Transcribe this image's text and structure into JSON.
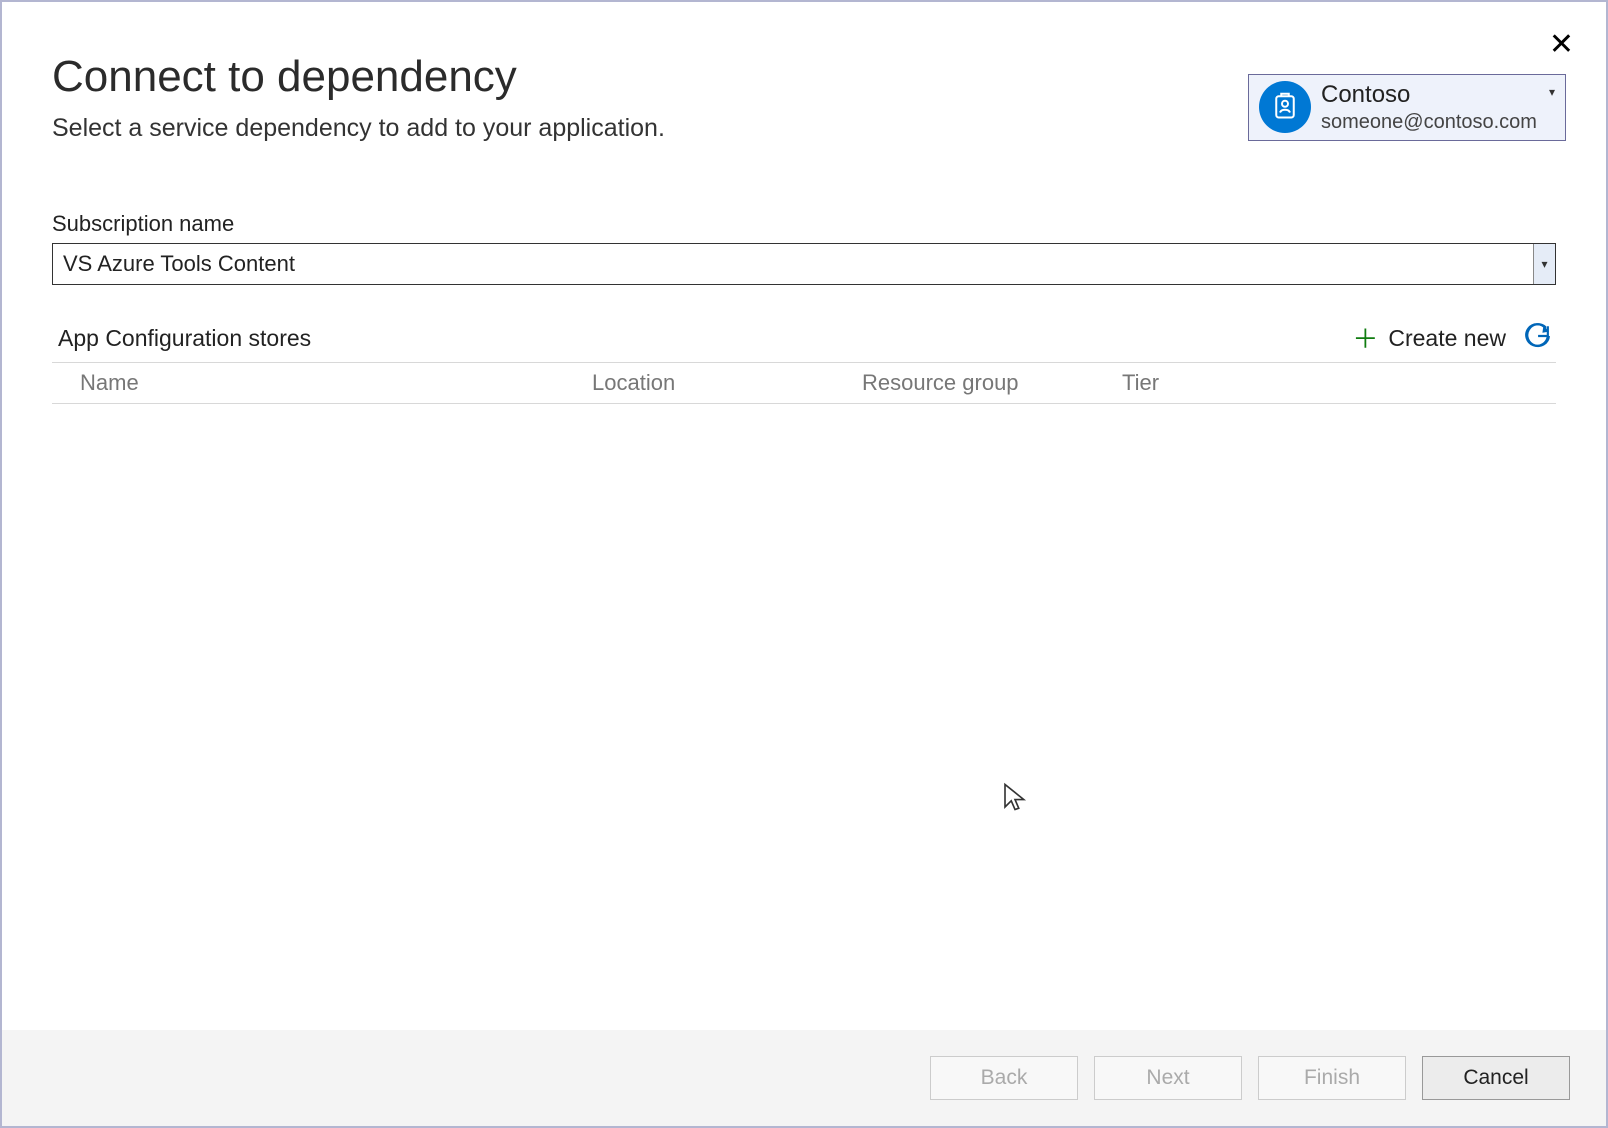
{
  "header": {
    "title": "Connect to dependency",
    "subtitle": "Select a service dependency to add to your application."
  },
  "account": {
    "name": "Contoso",
    "email": "someone@contoso.com"
  },
  "subscription": {
    "label": "Subscription name",
    "value": "VS Azure Tools Content"
  },
  "list": {
    "title": "App Configuration stores",
    "create_new_label": "Create new",
    "columns": {
      "name": "Name",
      "location": "Location",
      "resource_group": "Resource group",
      "tier": "Tier"
    }
  },
  "buttons": {
    "back": "Back",
    "next": "Next",
    "finish": "Finish",
    "cancel": "Cancel"
  }
}
